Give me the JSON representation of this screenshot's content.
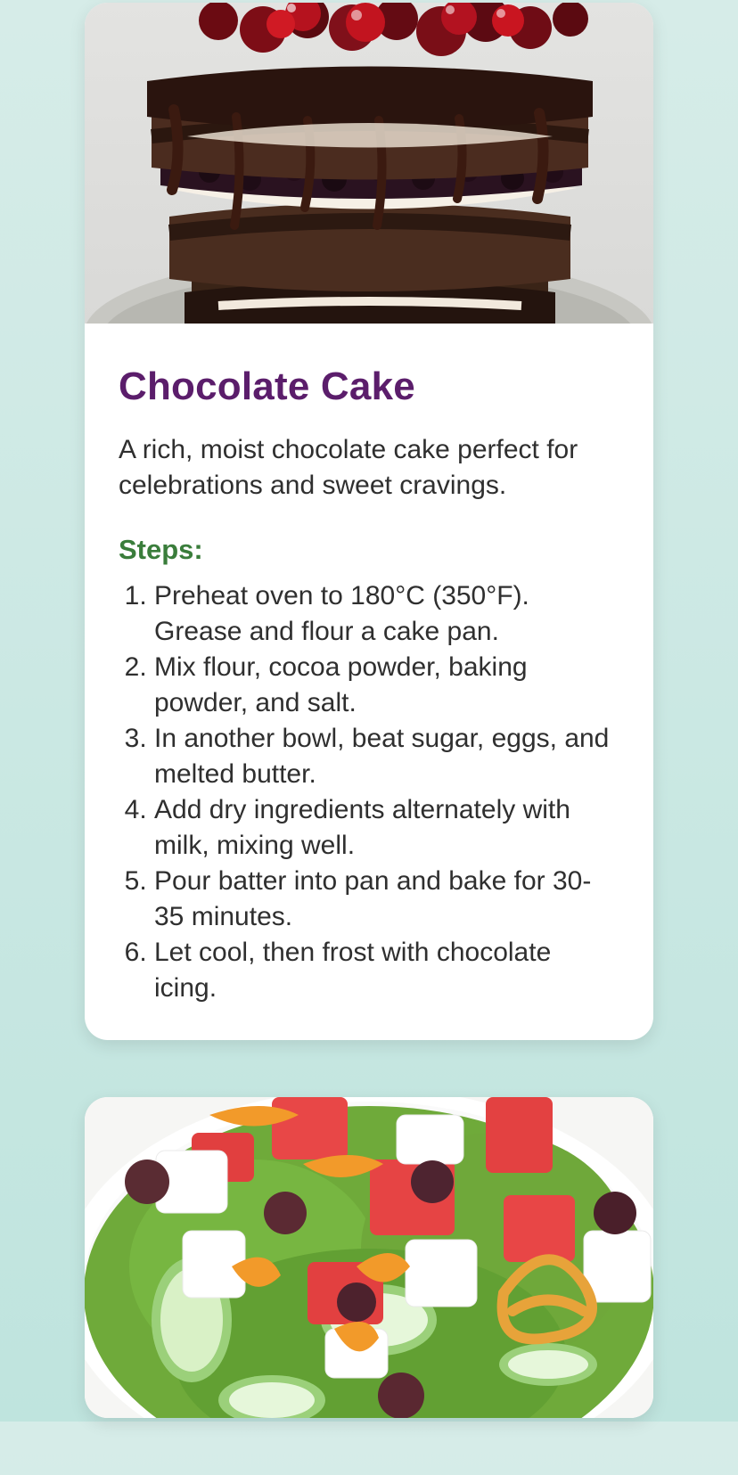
{
  "recipes": [
    {
      "image_alt": "Chocolate cake with cherries",
      "title": "Chocolate Cake",
      "description": "A rich, moist chocolate cake perfect for celebrations and sweet cravings.",
      "steps_heading": "Steps:",
      "steps": [
        "Preheat oven to 180°C (350°F). Grease and flour a cake pan.",
        "Mix flour, cocoa powder, baking powder, and salt.",
        "In another bowl, beat sugar, eggs, and melted butter.",
        "Add dry ingredients alternately with milk, mixing well.",
        "Pour batter into pan and bake for 30-35 minutes.",
        "Let cool, then frost with chocolate icing."
      ]
    },
    {
      "image_alt": "Watermelon feta salad"
    }
  ],
  "colors": {
    "title": "#5b1d6b",
    "steps_heading": "#3a7d3b",
    "text": "#2f2f2f",
    "background": "#cbe8e3"
  }
}
